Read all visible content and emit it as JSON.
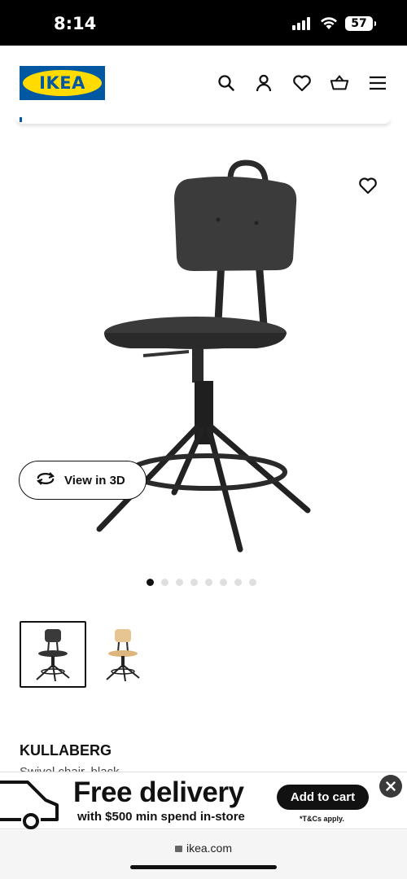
{
  "status_bar": {
    "time": "8:14",
    "battery": "57"
  },
  "header": {
    "logo_text": "IKEA",
    "brand_blue": "#0058a3",
    "brand_yellow": "#ffdb00",
    "icons": [
      "search-icon",
      "user-icon",
      "heart-icon",
      "basket-icon",
      "menu-icon"
    ]
  },
  "product": {
    "view_3d_label": "View in 3D",
    "image_count": 8,
    "active_image_index": 0,
    "name": "KULLABERG",
    "description": "Swivel chair, black",
    "thumbnails": [
      {
        "variant": "black",
        "selected": true
      },
      {
        "variant": "pine",
        "selected": false
      }
    ]
  },
  "banner": {
    "title": "Free delivery",
    "subtitle": "with $500 min spend in-store",
    "cta": "Add to cart",
    "terms": "*T&Cs apply."
  },
  "browser": {
    "url": "ikea.com"
  }
}
